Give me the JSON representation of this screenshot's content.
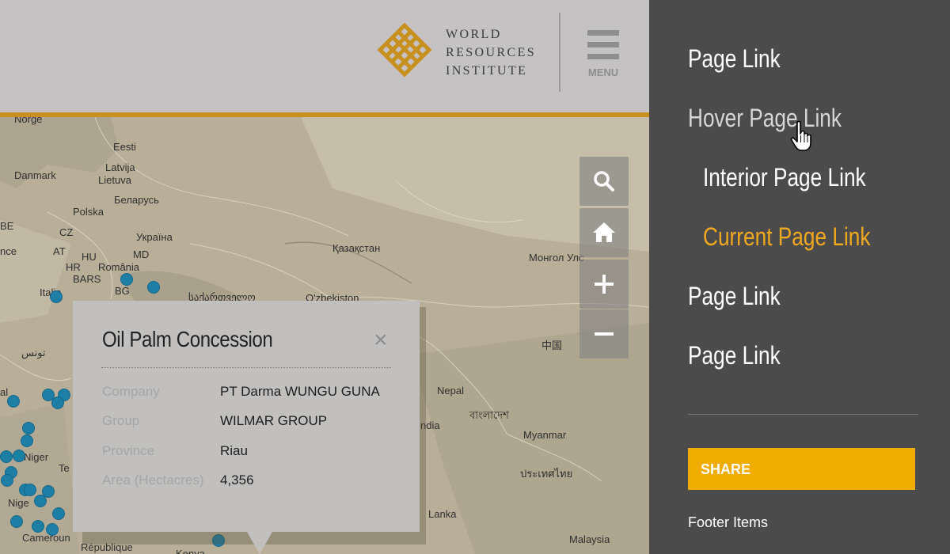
{
  "header": {
    "logo_lines": [
      "WORLD",
      "RESOURCES",
      "INSTITUTE"
    ],
    "menu_label": "MENU",
    "accent_color": "#c8901e"
  },
  "map": {
    "places": [
      {
        "id": "norge",
        "label": "Norge"
      },
      {
        "id": "eesti",
        "label": "Eesti"
      },
      {
        "id": "danmark",
        "label": "Danmark"
      },
      {
        "id": "latvija",
        "label": "Latvija"
      },
      {
        "id": "lietuva",
        "label": "Lietuva"
      },
      {
        "id": "belarus",
        "label": "Беларусь"
      },
      {
        "id": "polska",
        "label": "Polska"
      },
      {
        "id": "be",
        "label": "BE"
      },
      {
        "id": "cz",
        "label": "CZ"
      },
      {
        "id": "ukraina",
        "label": "Україна"
      },
      {
        "id": "nce",
        "label": "nce"
      },
      {
        "id": "at",
        "label": "AT"
      },
      {
        "id": "hu",
        "label": "HU"
      },
      {
        "id": "md",
        "label": "MD"
      },
      {
        "id": "hr",
        "label": "HR"
      },
      {
        "id": "romania",
        "label": "România"
      },
      {
        "id": "bars",
        "label": "BARS"
      },
      {
        "id": "italia",
        "label": "Italia"
      },
      {
        "id": "bg",
        "label": "BG"
      },
      {
        "id": "georgia",
        "label": "საქართველო"
      },
      {
        "id": "kazakhstan",
        "label": "Қазақстан"
      },
      {
        "id": "mongolia",
        "label": "Монгол Улс"
      },
      {
        "id": "uzbekistan",
        "label": "O'zbekiston"
      },
      {
        "id": "tunis",
        "label": "تونس"
      },
      {
        "id": "china",
        "label": "中国"
      },
      {
        "id": "al",
        "label": "al"
      },
      {
        "id": "nepal",
        "label": "Nepal"
      },
      {
        "id": "bangladesh",
        "label": "বাংলাদেশ"
      },
      {
        "id": "india",
        "label": "ndia"
      },
      {
        "id": "myanmar",
        "label": "Myanmar"
      },
      {
        "id": "niger",
        "label": "Niger"
      },
      {
        "id": "te",
        "label": "Te"
      },
      {
        "id": "thailand",
        "label": "ประเทศไทย"
      },
      {
        "id": "nige",
        "label": "Nige"
      },
      {
        "id": "lanka",
        "label": "Lanka"
      },
      {
        "id": "cameroun",
        "label": "Cameroun"
      },
      {
        "id": "malaysia",
        "label": "Malaysia"
      },
      {
        "id": "republique",
        "label": "République"
      },
      {
        "id": "kenya",
        "label": "Kenya"
      }
    ],
    "controls": [
      {
        "id": "search",
        "icon": "search-icon"
      },
      {
        "id": "home",
        "icon": "home-icon"
      },
      {
        "id": "zoom-in",
        "icon": "plus-icon"
      },
      {
        "id": "zoom-out",
        "icon": "minus-icon"
      }
    ],
    "marker_color": "#1e7fa6"
  },
  "popup": {
    "title": "Oil Palm Concession",
    "close_icon": "close-icon",
    "rows": [
      {
        "label": "Company",
        "value": "PT Darma WUNGU GUNA"
      },
      {
        "label": "Group",
        "value": "WILMAR GROUP"
      },
      {
        "label": "Province",
        "value": "Riau"
      },
      {
        "label": "Area (Hectacres)",
        "value": "4,356"
      }
    ]
  },
  "side_panel": {
    "links": [
      {
        "label": "Page Link",
        "state": "normal"
      },
      {
        "label": "Hover Page Link",
        "state": "hover"
      },
      {
        "label": "Interior Page Link",
        "state": "interior"
      },
      {
        "label": "Current Page Link",
        "state": "current"
      },
      {
        "label": "Page Link",
        "state": "normal"
      },
      {
        "label": "Page Link",
        "state": "normal"
      }
    ],
    "share_label": "SHARE",
    "footer_label": "Footer Items",
    "current_color": "#f0a81e",
    "share_color": "#f0ac00"
  }
}
